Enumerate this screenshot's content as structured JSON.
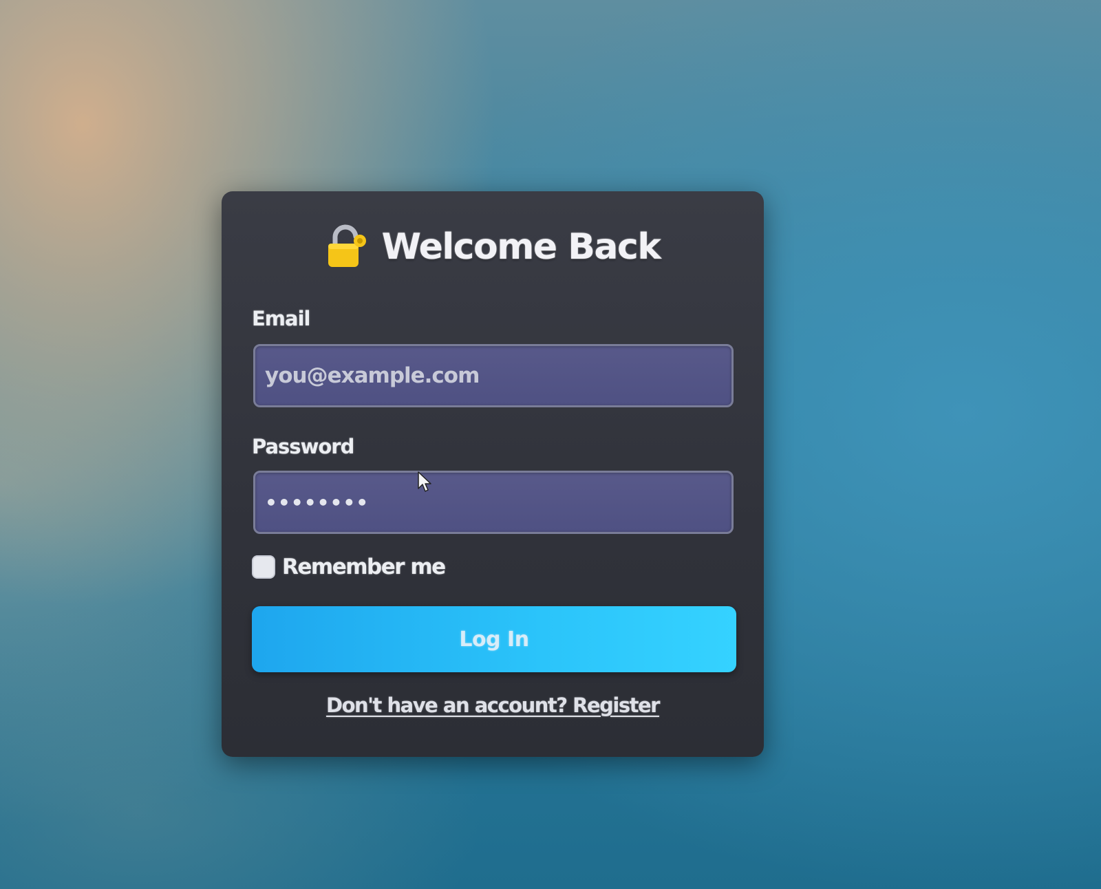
{
  "login": {
    "title": "Welcome Back",
    "email_label": "Email",
    "email_placeholder": "you@example.com",
    "password_label": "Password",
    "password_value": "••••••••",
    "remember_label": "Remember me",
    "remember_checked": false,
    "login_button": "Log In",
    "register_link": "Don't have an account? Register"
  },
  "icons": {
    "title_icon": "unlocked-padlock-icon",
    "pointer": "mouse-pointer-icon"
  },
  "colors": {
    "card_background": "#33353d",
    "field_background": "#55578a",
    "button_accent": "#2bc4fa",
    "lock_color": "#f5c518"
  }
}
